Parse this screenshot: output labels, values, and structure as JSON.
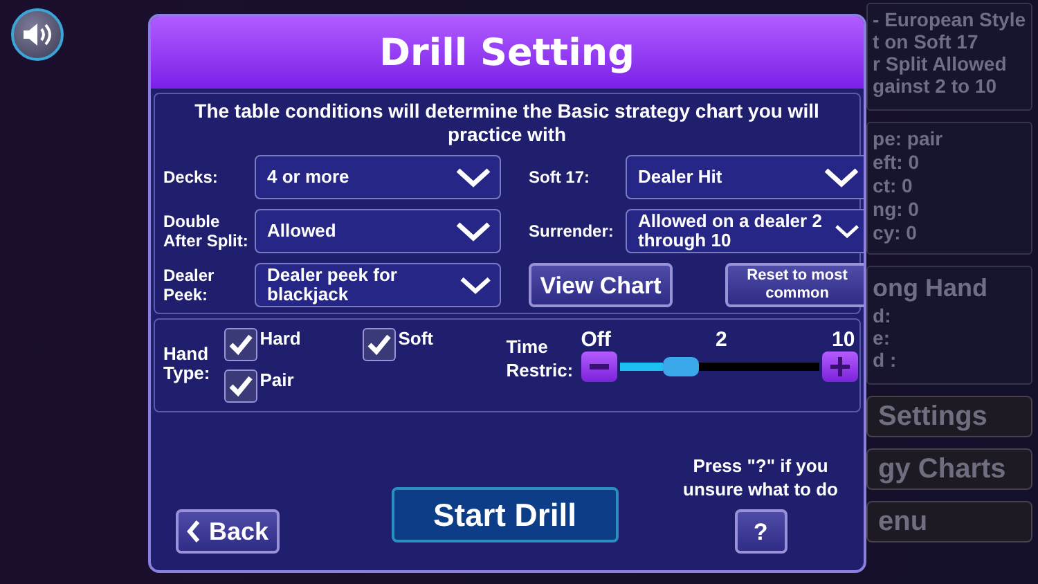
{
  "sound_button": {
    "on": true
  },
  "background": {
    "rules_panel": [
      "- European Style",
      "t on Soft 17",
      "r Split Allowed",
      "gainst 2 to 10"
    ],
    "stats_panel": [
      "pe: pair",
      "eft: 0",
      "ct: 0",
      "ng: 0",
      "cy: 0"
    ],
    "wrong_hand_panel": {
      "title": "ong Hand",
      "lines": [
        "d:",
        "e:",
        "d :"
      ]
    },
    "buttons": [
      "Settings",
      "gy Charts",
      "enu"
    ]
  },
  "dialog": {
    "title": "Drill Setting",
    "intro": "The table conditions will determine the Basic strategy chart you will practice with",
    "settings": [
      {
        "label": "Decks:",
        "value": "4 or more"
      },
      {
        "label": "Soft 17:",
        "value": "Dealer Hit"
      },
      {
        "label": "Double After Split:",
        "value": "Allowed"
      },
      {
        "label": "Surrender:",
        "value": "Allowed on a dealer 2 through 10"
      },
      {
        "label": "Dealer Peek:",
        "value": "Dealer peek for blackjack"
      }
    ],
    "view_chart": "View Chart",
    "reset": "Reset to most common",
    "hand_type": {
      "label": "Hand Type:",
      "options": [
        {
          "label": "Hard",
          "checked": true
        },
        {
          "label": "Soft",
          "checked": true
        },
        {
          "label": "Pair",
          "checked": true
        }
      ]
    },
    "time": {
      "label": "Time Restric:",
      "min": "Off",
      "current": "2",
      "max": "10",
      "level": 0.22
    },
    "start": "Start Drill",
    "back": "Back",
    "help_text": "Press \"?\" if you unsure what to do",
    "help": "?"
  }
}
